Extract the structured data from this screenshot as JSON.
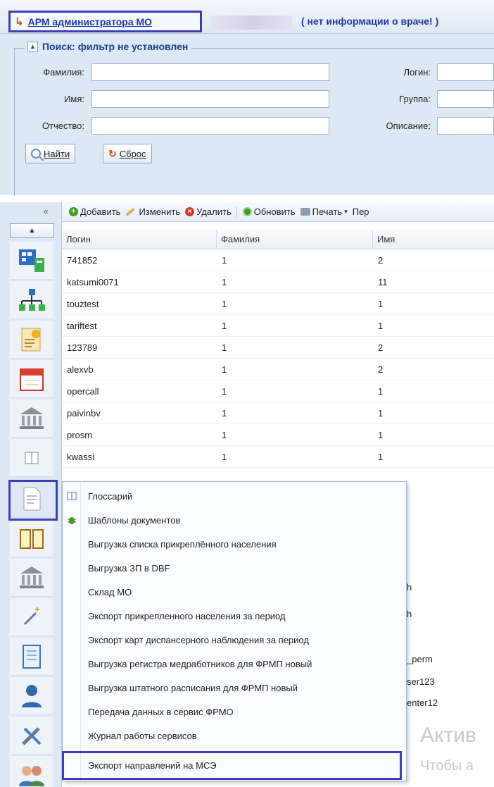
{
  "header": {
    "app_title": "АРМ администратора МО",
    "doctor_info": "( нет информации о враче! )"
  },
  "search": {
    "legend": "Поиск: фильтр не установлен",
    "collapse_symbol": "▲",
    "fields": {
      "surname_label": "Фамилия:",
      "name_label": "Имя:",
      "patronymic_label": "Отчество:",
      "login_label": "Логин:",
      "group_label": "Группа:",
      "description_label": "Описание:"
    },
    "find_button": "Найти",
    "reset_button": "Сброс"
  },
  "rail": {
    "collapse_symbol": "«",
    "up_symbol": "▲",
    "icons": [
      "structure-icon",
      "hierarchy-icon",
      "certificate-icon",
      "calendar-icon",
      "bank-icon",
      "book-small-icon",
      "document-icon",
      "book-icon",
      "bank-icon-2",
      "wand-icon",
      "notebook-icon",
      "user-icon",
      "tools-icon",
      "users-group-icon"
    ]
  },
  "toolbar": {
    "add": "Добавить",
    "edit": "Изменить",
    "delete": "Удалить",
    "refresh": "Обновить",
    "print": "Печать",
    "more": "Пер"
  },
  "grid": {
    "columns": [
      "Логин",
      "Фамилия",
      "Имя"
    ],
    "rows": [
      [
        "741852",
        "1",
        "2"
      ],
      [
        "katsumi0071",
        "1",
        "11"
      ],
      [
        "touztest",
        "1",
        "1"
      ],
      [
        "tariftest",
        "1",
        "1"
      ],
      [
        "123789",
        "1",
        "2"
      ],
      [
        "alexvb",
        "1",
        "2"
      ],
      [
        "opercall",
        "1",
        "1"
      ],
      [
        "paivinbv",
        "1",
        "1"
      ],
      [
        "prosm",
        "1",
        "1"
      ],
      [
        "kwassi",
        "1",
        "1"
      ]
    ],
    "partial_cells": [
      "h",
      "h",
      "_perm",
      "ser123",
      "enter12"
    ]
  },
  "watermark": {
    "line1": "Актив",
    "line2": "Чтобы а"
  },
  "menu": {
    "items": [
      {
        "label": "Глоссарий",
        "icon": "glossary-icon"
      },
      {
        "label": "Шаблоны документов",
        "icon": "bug-icon"
      },
      {
        "label": "Выгрузка списка прикреплённого населения",
        "icon": ""
      },
      {
        "label": "Выгрузка ЗП в DBF",
        "icon": ""
      },
      {
        "label": "Склад МО",
        "icon": ""
      },
      {
        "label": "Экспорт прикрепленного населения за период",
        "icon": ""
      },
      {
        "label": "Экспорт карт диспансерного наблюдения за период",
        "icon": ""
      },
      {
        "label": "Выгрузка регистра медработников для ФРМП новый",
        "icon": ""
      },
      {
        "label": "Выгрузка штатного расписания для ФРМП новый",
        "icon": ""
      },
      {
        "label": "Передача данных в сервис ФРМО",
        "icon": ""
      },
      {
        "label": "Журнал работы сервисов",
        "icon": ""
      },
      {
        "label": "Экспорт направлений на МСЭ",
        "icon": ""
      }
    ]
  },
  "colors": {
    "highlight": "#3a3fb8",
    "panel_bg": "#dde8f5",
    "title_blue": "#1c37a6"
  }
}
